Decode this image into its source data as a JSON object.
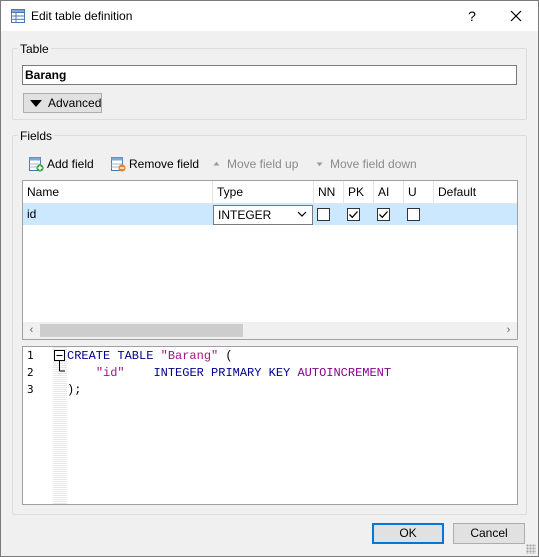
{
  "window": {
    "title": "Edit table definition",
    "help_glyph": "?",
    "close_glyph": "✕"
  },
  "table_group": {
    "label": "Table",
    "name_value": "Barang",
    "advanced_label": "Advanced"
  },
  "fields_group": {
    "label": "Fields",
    "toolbar": {
      "add": "Add field",
      "remove": "Remove field",
      "move_up": "Move field up",
      "move_down": "Move field down"
    },
    "columns": [
      "Name",
      "Type",
      "NN",
      "PK",
      "AI",
      "U",
      "Default"
    ],
    "rows": [
      {
        "name": "id",
        "type": "INTEGER",
        "nn": false,
        "pk": true,
        "ai": true,
        "u": false,
        "default": ""
      }
    ]
  },
  "sql": {
    "line_numbers": [
      "1",
      "2",
      "3"
    ],
    "fold_marker": "−",
    "line1": {
      "kw": "CREATE TABLE ",
      "str": "\"Barang\"",
      "rest": " ("
    },
    "line2": {
      "indent": "    ",
      "str": "\"id\"",
      "gap": "    ",
      "kw": "INTEGER PRIMARY KEY ",
      "fn": "AUTOINCREMENT"
    },
    "line3": {
      "text": ");"
    }
  },
  "buttons": {
    "ok": "OK",
    "cancel": "Cancel"
  },
  "colors": {
    "selection": "#cce8ff",
    "keyword": "#00008b",
    "string": "#a0158b",
    "accent": "#0078d7"
  }
}
